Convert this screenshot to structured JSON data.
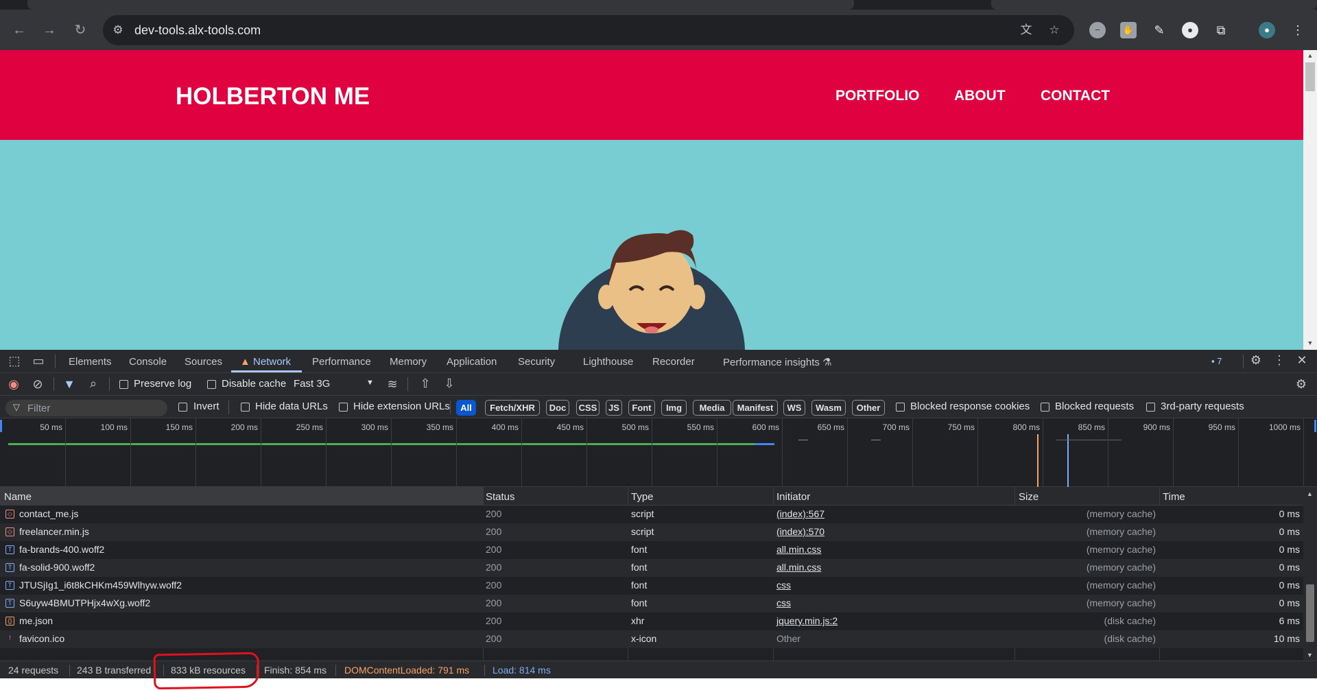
{
  "browser": {
    "url": "dev-tools.alx-tools.com",
    "back_icon": "back-arrow-icon",
    "forward_icon": "forward-arrow-icon",
    "reload_icon": "reload-icon"
  },
  "website": {
    "brand": "HOLBERTON ME",
    "nav": [
      "PORTFOLIO",
      "ABOUT",
      "CONTACT"
    ],
    "header_color": "#df0140",
    "hero_color": "#77cdd1"
  },
  "devtools": {
    "tabs": [
      "Elements",
      "Console",
      "Sources",
      "Network",
      "Performance",
      "Memory",
      "Application",
      "Security",
      "Lighthouse",
      "Recorder",
      "Performance insights"
    ],
    "active_tab": "Network",
    "issues_count": "7",
    "toolbar": {
      "preserve_log": "Preserve log",
      "disable_cache": "Disable cache",
      "throttling": "Fast 3G"
    },
    "filter": {
      "placeholder": "Filter",
      "invert": "Invert",
      "hide_data_urls": "Hide data URLs",
      "hide_extension_urls": "Hide extension URLs",
      "types": [
        "All",
        "Fetch/XHR",
        "Doc",
        "CSS",
        "JS",
        "Font",
        "Img",
        "Media",
        "Manifest",
        "WS",
        "Wasm",
        "Other"
      ],
      "blocked_response_cookies": "Blocked response cookies",
      "blocked_requests": "Blocked requests",
      "third_party": "3rd-party requests"
    },
    "timeline_ticks": [
      "50 ms",
      "100 ms",
      "150 ms",
      "200 ms",
      "250 ms",
      "300 ms",
      "350 ms",
      "400 ms",
      "450 ms",
      "500 ms",
      "550 ms",
      "600 ms",
      "650 ms",
      "700 ms",
      "750 ms",
      "800 ms",
      "850 ms",
      "900 ms",
      "950 ms",
      "1000 ms"
    ],
    "columns": [
      "Name",
      "Status",
      "Type",
      "Initiator",
      "Size",
      "Time"
    ],
    "requests": [
      {
        "name": "contact_me.js",
        "icon": "script-file-icon",
        "status": "200",
        "type": "script",
        "initiator": "(index):567",
        "size": "(memory cache)",
        "time": "0 ms"
      },
      {
        "name": "freelancer.min.js",
        "icon": "script-file-icon",
        "status": "200",
        "type": "script",
        "initiator": "(index):570",
        "size": "(memory cache)",
        "time": "0 ms"
      },
      {
        "name": "fa-brands-400.woff2",
        "icon": "font-file-icon",
        "status": "200",
        "type": "font",
        "initiator": "all.min.css",
        "size": "(memory cache)",
        "time": "0 ms"
      },
      {
        "name": "fa-solid-900.woff2",
        "icon": "font-file-icon",
        "status": "200",
        "type": "font",
        "initiator": "all.min.css",
        "size": "(memory cache)",
        "time": "0 ms"
      },
      {
        "name": "JTUSjIg1_i6t8kCHKm459Wlhyw.woff2",
        "icon": "font-file-icon",
        "status": "200",
        "type": "font",
        "initiator": "css",
        "size": "(memory cache)",
        "time": "0 ms"
      },
      {
        "name": "S6uyw4BMUTPHjx4wXg.woff2",
        "icon": "font-file-icon",
        "status": "200",
        "type": "font",
        "initiator": "css",
        "size": "(memory cache)",
        "time": "0 ms"
      },
      {
        "name": "me.json",
        "icon": "json-file-icon",
        "status": "200",
        "type": "xhr",
        "initiator": "jquery.min.js:2",
        "size": "(disk cache)",
        "time": "6 ms"
      },
      {
        "name": "favicon.ico",
        "icon": "image-file-icon",
        "status": "200",
        "type": "x-icon",
        "initiator": "Other",
        "size": "(disk cache)",
        "time": "10 ms"
      }
    ],
    "summary": {
      "requests": "24 requests",
      "transferred": "243 B transferred",
      "resources": "833 kB resources",
      "finish": "Finish: 854 ms",
      "dom_content_loaded": "DOMContentLoaded: 791 ms",
      "load": "Load: 814 ms"
    },
    "colors": {
      "dom_content_loaded": "#f9a266",
      "load": "#7cacf8",
      "accent": "#a8c7fa"
    }
  }
}
